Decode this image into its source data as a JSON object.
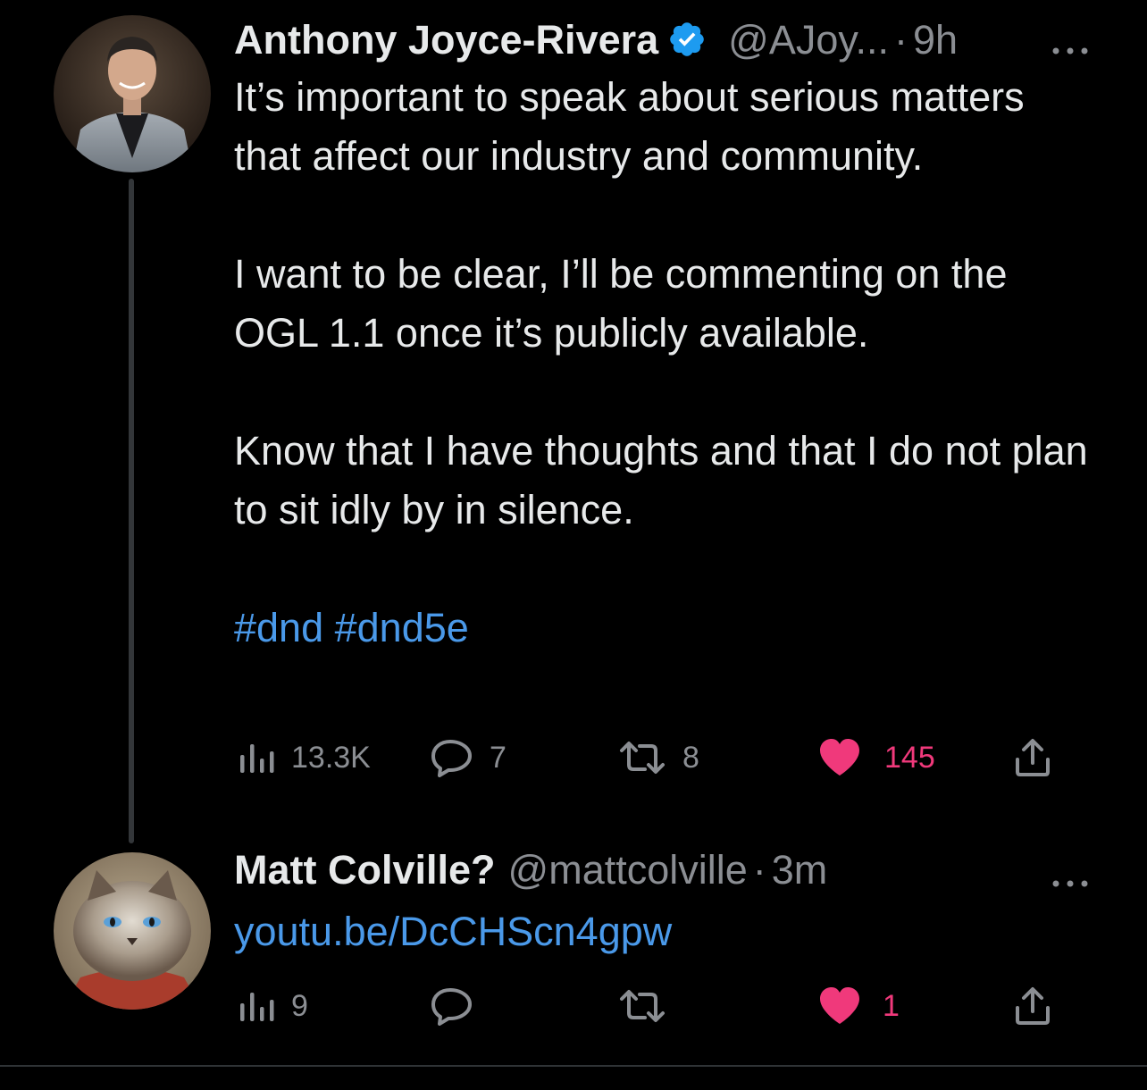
{
  "tweets": [
    {
      "author_name": "Anthony Joyce-Rivera",
      "verified": true,
      "handle": "@AJoy...",
      "separator": "·",
      "time": "9h",
      "paragraphs": [
        "It’s important to speak about serious matters that affect our industry and community.",
        "I want to be clear, I’ll be commenting on the OGL 1.1 once it’s publicly available.",
        "Know that I have thoughts and that I do not plan to sit idly by in silence."
      ],
      "hashtags": "#dnd #dnd5e",
      "views": "13.3K",
      "replies": "7",
      "retweets": "8",
      "likes": "145",
      "liked": true
    },
    {
      "author_name": "Matt Colville?",
      "verified": false,
      "handle": "@mattcolville",
      "separator": "·",
      "time": "3m",
      "link": "youtu.be/DcCHScn4gpw",
      "views": "9",
      "replies": "",
      "retweets": "",
      "likes": "1",
      "liked": true
    }
  ],
  "colors": {
    "background": "#000000",
    "text": "#e7e9ea",
    "muted": "#8b8e93",
    "link": "#4a99e9",
    "like": "#f0397b",
    "verified": "#1d9bf0"
  },
  "icons": [
    "avatar-portrait",
    "verified-badge-icon",
    "more-options-icon",
    "views-icon",
    "reply-icon",
    "retweet-icon",
    "heart-icon",
    "share-icon"
  ]
}
